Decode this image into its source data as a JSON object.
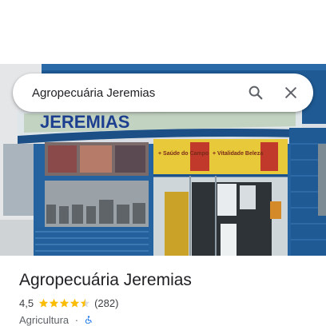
{
  "search": {
    "query": "Agropecuária Jeremias",
    "search_icon": "search-icon",
    "close_icon": "close-icon"
  },
  "photo": {
    "sign_text": "JEREMIAS",
    "window_text_1": "+ Saúde do Campo",
    "window_text_2": "+ Vitalidade Beleza"
  },
  "place": {
    "name": "Agropecuária Jeremias",
    "rating": "4,5",
    "rating_value": 4.5,
    "reviews": "(282)",
    "category": "Agricultura",
    "separator": "·",
    "accessibility_icon": "wheelchair-icon"
  },
  "colors": {
    "star": "#fbbc04",
    "star_empty": "#dadce0",
    "accent_blue": "#1a73e8",
    "storefront_blue": "#1f5a94"
  }
}
